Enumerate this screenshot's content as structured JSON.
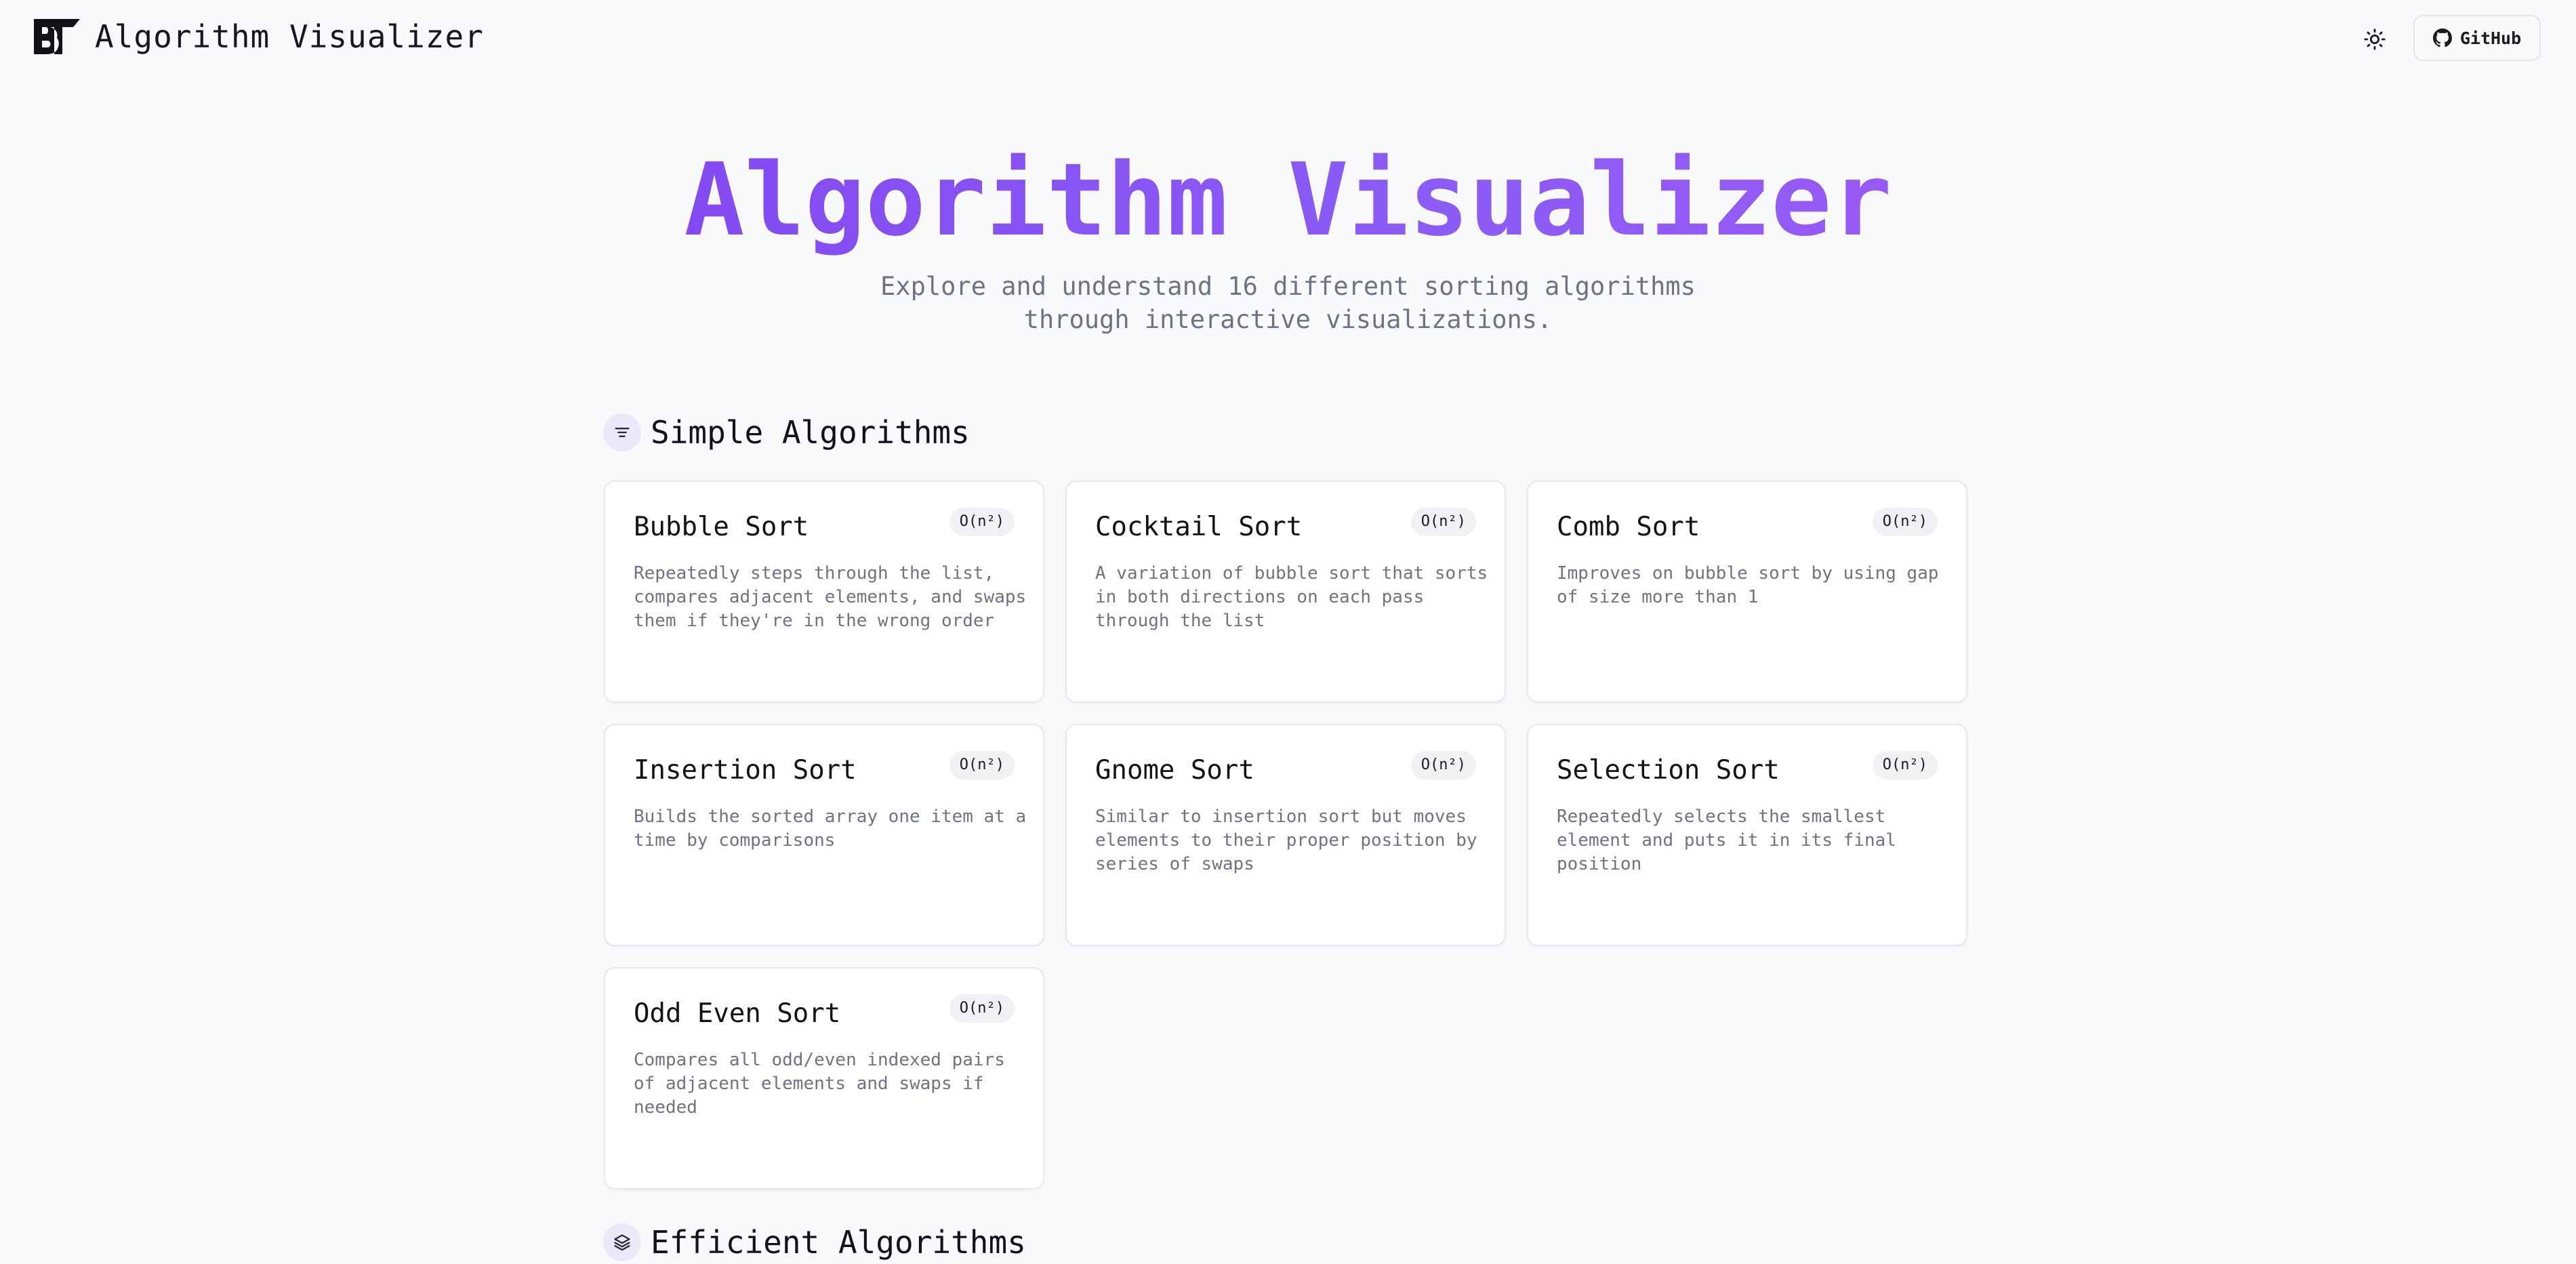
{
  "header": {
    "brand_title": "Algorithm Visualizer",
    "github_label": "GitHub"
  },
  "hero": {
    "title": "Algorithm Visualizer",
    "subtitle_line1": "Explore and understand 16 different sorting algorithms",
    "subtitle_line2": "through interactive visualizations."
  },
  "sections": [
    {
      "title": "Simple Algorithms",
      "icon": "align-center-icon",
      "cards": [
        {
          "name": "Bubble Sort",
          "complexity": "O(n²)",
          "description": "Repeatedly steps through the list, compares adjacent elements, and swaps them if they're in the wrong order"
        },
        {
          "name": "Cocktail Sort",
          "complexity": "O(n²)",
          "description": "A variation of bubble sort that sorts in both directions on each pass through the list"
        },
        {
          "name": "Comb Sort",
          "complexity": "O(n²)",
          "description": "Improves on bubble sort by using gap of size more than 1"
        },
        {
          "name": "Insertion Sort",
          "complexity": "O(n²)",
          "description": "Builds the sorted array one item at a time by comparisons"
        },
        {
          "name": "Gnome Sort",
          "complexity": "O(n²)",
          "description": "Similar to insertion sort but moves elements to their proper position by series of swaps"
        },
        {
          "name": "Selection Sort",
          "complexity": "O(n²)",
          "description": "Repeatedly selects the smallest element and puts it in its final position"
        },
        {
          "name": "Odd Even Sort",
          "complexity": "O(n²)",
          "description": "Compares all odd/even indexed pairs of adjacent elements and swaps if needed"
        }
      ]
    },
    {
      "title": "Efficient Algorithms",
      "icon": "layers-icon",
      "cards": []
    }
  ],
  "colors": {
    "background": "#f8f9fb",
    "accent_gradient_start": "#7c3aed",
    "accent_gradient_end": "#a855f7",
    "muted_text": "#6f7381",
    "card_border": "#e7e7ec"
  }
}
